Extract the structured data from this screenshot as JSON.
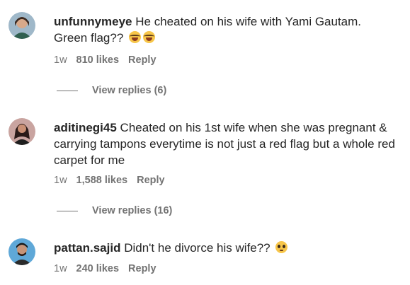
{
  "comments": [
    {
      "username": "unfunnymeye",
      "text": "He cheated on his wife with Yami Gautam. Green flag??",
      "emoji": "laughing-tears-emoji",
      "time": "1w",
      "likes": "810 likes",
      "reply": "Reply",
      "view_replies": "View replies (6)"
    },
    {
      "username": "aditinegi45",
      "text": "Cheated on his 1st wife when she was pregnant & carrying tampons everytime is not just a red flag but a whole red carpet for me",
      "time": "1w",
      "likes": "1,588 likes",
      "reply": "Reply",
      "view_replies": "View replies (16)"
    },
    {
      "username": "pattan.sajid",
      "text": "Didn't he divorce his wife??",
      "emoji": "pleading-face-emoji",
      "time": "1w",
      "likes": "240 likes",
      "reply": "Reply"
    }
  ],
  "colors": {
    "text": "#262626",
    "secondary": "#737373"
  }
}
